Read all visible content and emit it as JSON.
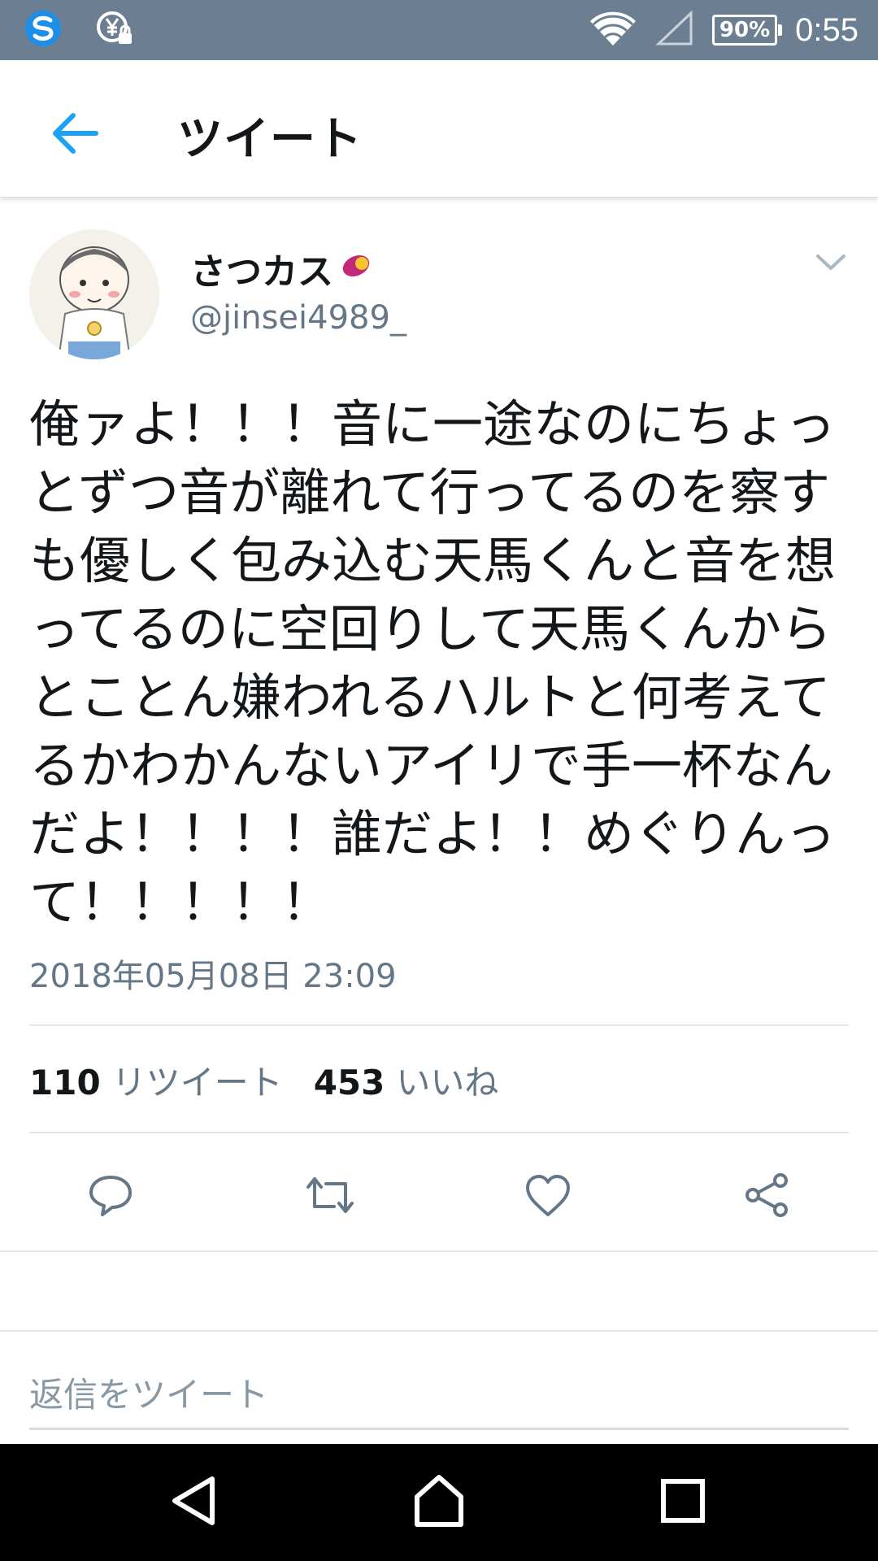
{
  "status_bar": {
    "battery": "90%",
    "time": "0:55",
    "icons": [
      "s-app-icon",
      "yen-lock-icon",
      "wifi-icon",
      "signal-icon",
      "battery-icon"
    ]
  },
  "header": {
    "title": "ツイート",
    "back_icon": "arrow-left-icon",
    "accent_color": "#1da1f2"
  },
  "tweet": {
    "display_name": "さつカス",
    "name_emoji": "sweet-potato-icon",
    "username": "@jinsei4989_",
    "text": "俺ァよ！！！音に一途なのにちょっとずつ音が離れて行ってるのを察すも優しく包み込む天馬くんと音を想ってるのに空回りして天馬くんからとことん嫌われるハルトと何考えてるかわかんないアイリで手一杯なんだよ！！！！誰だよ！！めぐりんって！！！！！",
    "timestamp": "2018年05月08日 23:09",
    "retweet_count": "110",
    "retweet_label": "リツイート",
    "like_count": "453",
    "like_label": "いいね"
  },
  "actions": [
    "reply-icon",
    "retweet-icon",
    "like-icon",
    "share-icon"
  ],
  "reply": {
    "placeholder": "返信をツイート"
  },
  "navbar": [
    "back-nav-icon",
    "home-nav-icon",
    "recents-nav-icon"
  ]
}
